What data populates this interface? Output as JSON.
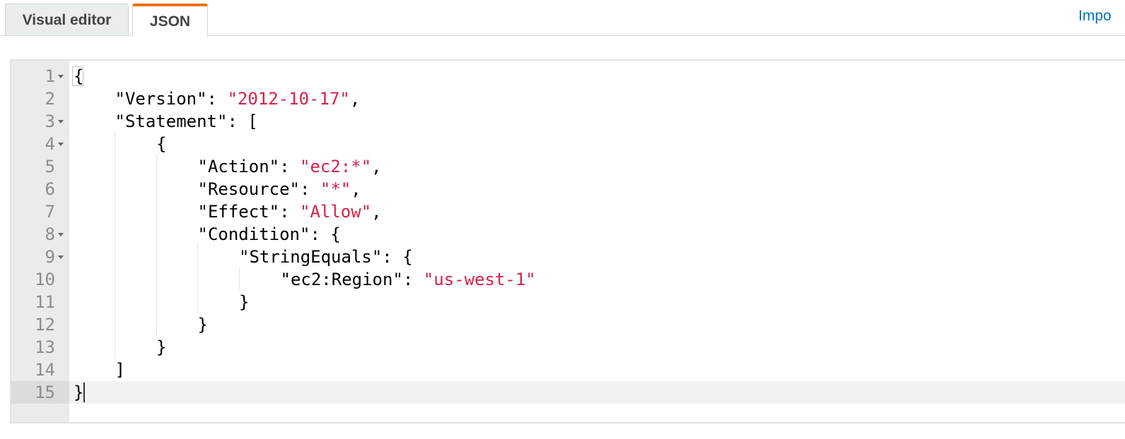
{
  "tabs": {
    "visual_editor": "Visual editor",
    "json": "JSON",
    "active": "JSON"
  },
  "import_link": "Impo",
  "editor": {
    "active_line": 15,
    "lines": [
      {
        "num": "1",
        "fold": true,
        "indent": 0,
        "parts": [
          [
            "p",
            "{"
          ]
        ]
      },
      {
        "num": "2",
        "fold": false,
        "indent": 1,
        "parts": [
          [
            "p",
            "\"Version\": "
          ],
          [
            "s",
            "\"2012-10-17\""
          ],
          [
            "p",
            ","
          ]
        ]
      },
      {
        "num": "3",
        "fold": true,
        "indent": 1,
        "parts": [
          [
            "p",
            "\"Statement\": ["
          ]
        ]
      },
      {
        "num": "4",
        "fold": true,
        "indent": 2,
        "parts": [
          [
            "p",
            "{"
          ]
        ]
      },
      {
        "num": "5",
        "fold": false,
        "indent": 3,
        "parts": [
          [
            "p",
            "\"Action\": "
          ],
          [
            "s",
            "\"ec2:*\""
          ],
          [
            "p",
            ","
          ]
        ]
      },
      {
        "num": "6",
        "fold": false,
        "indent": 3,
        "parts": [
          [
            "p",
            "\"Resource\": "
          ],
          [
            "s",
            "\"*\""
          ],
          [
            "p",
            ","
          ]
        ]
      },
      {
        "num": "7",
        "fold": false,
        "indent": 3,
        "parts": [
          [
            "p",
            "\"Effect\": "
          ],
          [
            "s",
            "\"Allow\""
          ],
          [
            "p",
            ","
          ]
        ]
      },
      {
        "num": "8",
        "fold": true,
        "indent": 3,
        "parts": [
          [
            "p",
            "\"Condition\": {"
          ]
        ]
      },
      {
        "num": "9",
        "fold": true,
        "indent": 4,
        "parts": [
          [
            "p",
            "\"StringEquals\": {"
          ]
        ]
      },
      {
        "num": "10",
        "fold": false,
        "indent": 5,
        "parts": [
          [
            "p",
            "\"ec2:Region\": "
          ],
          [
            "s",
            "\"us-west-1\""
          ]
        ]
      },
      {
        "num": "11",
        "fold": false,
        "indent": 4,
        "parts": [
          [
            "p",
            "}"
          ]
        ]
      },
      {
        "num": "12",
        "fold": false,
        "indent": 3,
        "parts": [
          [
            "p",
            "}"
          ]
        ]
      },
      {
        "num": "13",
        "fold": false,
        "indent": 2,
        "parts": [
          [
            "p",
            "}"
          ]
        ]
      },
      {
        "num": "14",
        "fold": false,
        "indent": 1,
        "parts": [
          [
            "p",
            "]"
          ]
        ]
      },
      {
        "num": "15",
        "fold": false,
        "indent": 0,
        "parts": [
          [
            "p",
            "}"
          ]
        ]
      }
    ]
  },
  "colors": {
    "active_tab_accent": "#ec7211",
    "string_literal": "#d6214c",
    "link": "#0073bb"
  }
}
